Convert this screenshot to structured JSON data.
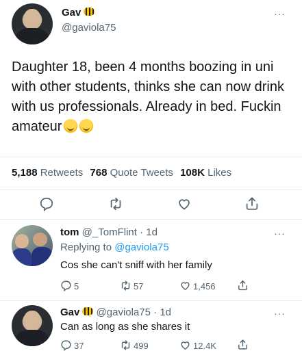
{
  "main_tweet": {
    "name": "Gav",
    "handle": "@gaviola75",
    "text": "Daughter 18, been 4 months boozing in uni with other students, thinks she can now drink with us professionals. Already in bed. Fuckin amateur",
    "stats": {
      "retweets": "5,188",
      "retweets_label": "Retweets",
      "quotes": "768",
      "quotes_label": "Quote Tweets",
      "likes": "108K",
      "likes_label": "Likes"
    }
  },
  "replies": [
    {
      "name": "tom",
      "handle": "@_TomFlint",
      "time": "· 1d",
      "replying_prefix": "Replying to",
      "replying_handle": "@gaviola75",
      "text": "Cos she can't sniff with her family",
      "counts": {
        "replies": "5",
        "retweets": "57",
        "likes": "1,456"
      }
    },
    {
      "name": "Gav",
      "handle": "@gaviola75",
      "time": "· 1d",
      "text": "Can as long as she shares it",
      "counts": {
        "replies": "37",
        "retweets": "499",
        "likes": "12.4K"
      }
    }
  ],
  "more_label": "···",
  "colors": {
    "accent": "#1d9bf0",
    "muted": "#536471",
    "text": "#0f1419",
    "divider": "#e6ecf0"
  },
  "icons": [
    "reply-icon",
    "retweet-icon",
    "like-icon",
    "share-icon",
    "more-icon",
    "bee-emoji-icon",
    "rofl-emoji-icon"
  ]
}
